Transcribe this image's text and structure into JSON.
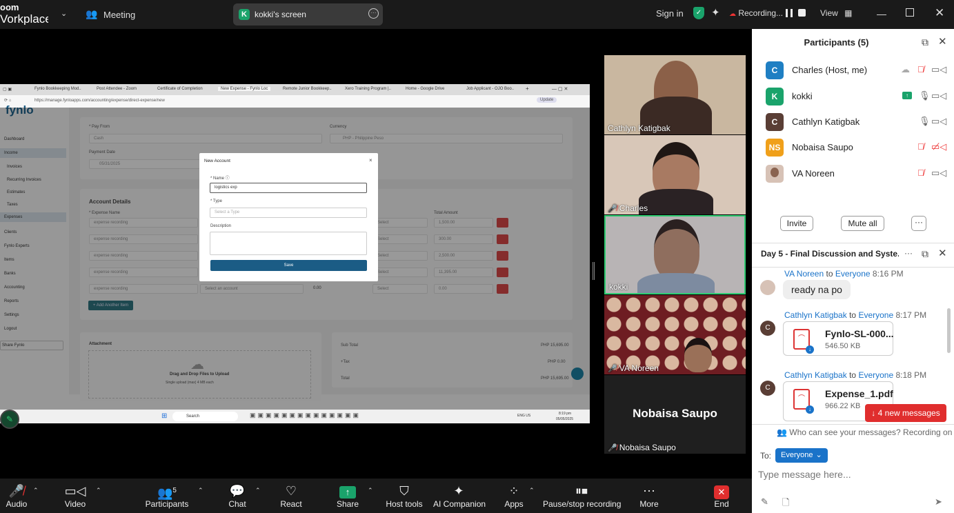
{
  "topbar": {
    "logo_line1": "oom",
    "logo_line2": "Vorkplace",
    "meeting_label": "Meeting",
    "share_badge": "K",
    "share_title": "kokki's screen",
    "sign_in": "Sign in",
    "recording": "Recording...",
    "view": "View"
  },
  "shared_screen": {
    "tabs": [
      "Fynlo Bookkeeping Mod..",
      "Post Attendee - Zoom",
      "Certificate of Completion",
      "New Expense - Fynlo Loc",
      "Remote Junior Bookkeep..",
      "Xero Training Program |..",
      "Home - Google Drive",
      "Job Applicant - OJO Boo.."
    ],
    "url": "https://manage.fynloapps.com/accounting/expense/direct-expense/new",
    "update_btn": "Update",
    "app_logo": "fynlo",
    "sidebar": [
      "Dashboard",
      "Income",
      "Invoices",
      "Recurring Invoices",
      "Estimates",
      "Taxes",
      "Expenses",
      "Clients",
      "Fynlo Experts",
      "Items",
      "Banks",
      "Accounting",
      "Reports",
      "Settings",
      "Logout"
    ],
    "share_fynlo": "Share Fynlo",
    "pay_from_label": "* Pay From",
    "pay_from_value": "Cash",
    "currency_label": "Currency",
    "currency_value": "PHP - Philippine Peso",
    "payment_date_label": "Payment Date",
    "payment_date_value": "05/31/2025",
    "account_details_title": "Account Details",
    "expense_name_label": "* Expense Name",
    "total_amount_label": "Total Amount",
    "expense_rows": [
      {
        "name": "expense recording",
        "amount": "1,500.00"
      },
      {
        "name": "expense recording",
        "amount": "300.00"
      },
      {
        "name": "expense recording",
        "amount": "2,500.00"
      },
      {
        "name": "expense recording",
        "amount": "11,395.00"
      },
      {
        "name": "expense recording",
        "amount": "0.00"
      }
    ],
    "select_account": "Select an account",
    "select_placeholder": "Select",
    "last_qty": "0.00",
    "add_item": "+ Add Another Item",
    "attachment_title": "Attachment",
    "drag_drop": "Drag and Drop Files to Upload",
    "upload_hint": "Single upload (max) 4 MB each",
    "sub_total_label": "Sub Total",
    "sub_total_value": "PHP 15,695.00",
    "tax_label": "+Tax",
    "tax_value": "PHP 0.00",
    "total_label": "Total",
    "total_value": "PHP 15,695.00",
    "modal": {
      "title": "New Account",
      "close": "×",
      "name_label": "* Name ⓘ",
      "name_value": "logistics exp",
      "type_label": "* Type",
      "type_placeholder": "Select a Type",
      "desc_label": "Description",
      "save": "Save"
    },
    "taskbar_search": "Search",
    "taskbar_lang": "ENG US",
    "taskbar_time": "8:19 pm",
    "taskbar_date": "05/05/2025"
  },
  "gallery": [
    {
      "name": "Cathlyn Katigbak",
      "muted": false,
      "bg": "#c9b7a0"
    },
    {
      "name": "Charles",
      "muted": true,
      "bg": "#d8c7b8"
    },
    {
      "name": "kokki",
      "muted": false,
      "bg": "#b8b4b5"
    },
    {
      "name": "VA Noreen",
      "muted": true,
      "bg": "#6e1d22"
    },
    {
      "name": "Nobaisa Saupo",
      "muted": true,
      "bg": "#1f1f1f",
      "center_label": "Nobaisa Saupo"
    }
  ],
  "participants": {
    "title": "Participants (5)",
    "list": [
      {
        "initial": "C",
        "name": "Charles (Host, me)",
        "color": "#1f7fc3"
      },
      {
        "initial": "K",
        "name": "kokki",
        "color": "#1aa36b"
      },
      {
        "initial": "C",
        "name": "Cathlyn Katigbak",
        "color": "#5a3e35"
      },
      {
        "initial": "NS",
        "name": "Nobaisa Saupo",
        "color": "#f0a01a"
      },
      {
        "initial": "",
        "name": "VA Noreen",
        "color": "#d7c2b6"
      }
    ],
    "invite": "Invite",
    "mute_all": "Mute all",
    "more": "···"
  },
  "chat": {
    "title": "Day 5 - Final Discussion and Syste...",
    "messages": [
      {
        "author": "VA Noreen",
        "to": "to",
        "target": "Everyone",
        "time": "8:16 PM",
        "text": "ready na po"
      },
      {
        "author": "Cathlyn Katigbak",
        "to": "to",
        "target": "Everyone",
        "time": "8:17 PM",
        "file": "Fynlo-SL-000...",
        "size": "546.50 KB"
      },
      {
        "author": "Cathlyn Katigbak",
        "to": "to",
        "target": "Everyone",
        "time": "8:18 PM",
        "file": "Expense_1.pdf",
        "size": "966.22 KB"
      }
    ],
    "avatar_initial": "C",
    "new_messages": "4 new messages",
    "who_can_see": "Who can see your messages? Recording on",
    "to_label": "To:",
    "to_value": "Everyone",
    "input_placeholder": "Type message here..."
  },
  "toolbar": {
    "audio": "Audio",
    "video": "Video",
    "participants": "Participants",
    "participants_count": "5",
    "chat": "Chat",
    "react": "React",
    "share": "Share",
    "host_tools": "Host tools",
    "ai_companion": "AI Companion",
    "apps": "Apps",
    "pause_stop": "Pause/stop recording",
    "more": "More",
    "end": "End"
  }
}
